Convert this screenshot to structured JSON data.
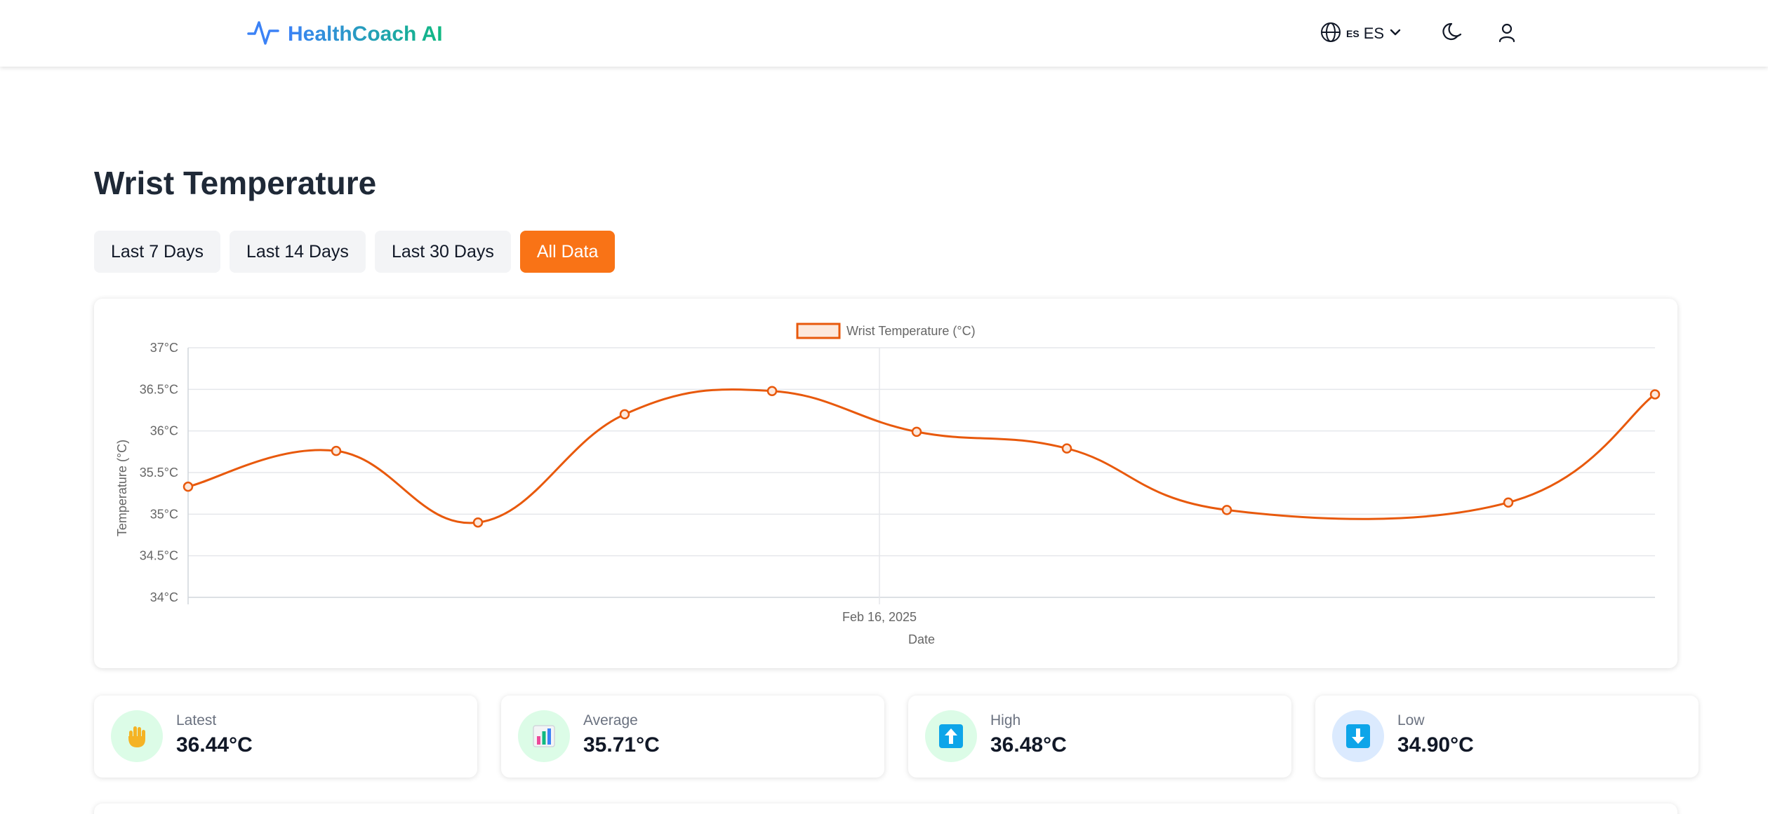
{
  "app": {
    "name": "HealthCoach AI"
  },
  "header": {
    "language_small": "ES",
    "language_code": "ES",
    "icons": [
      "globe-icon",
      "chevron-down-icon",
      "moon-icon",
      "user-icon"
    ]
  },
  "page": {
    "title": "Wrist Temperature"
  },
  "ranges": [
    {
      "label": "Last 7 Days",
      "active": false
    },
    {
      "label": "Last 14 Days",
      "active": false
    },
    {
      "label": "Last 30 Days",
      "active": false
    },
    {
      "label": "All Data",
      "active": true
    }
  ],
  "colors": {
    "accent": "#f97316",
    "line": "#e8590c",
    "grid": "#e5e7eb"
  },
  "chart_data": {
    "type": "line",
    "legend": {
      "label": "Wrist Temperature (°C)",
      "position": "top-center"
    },
    "xlabel": "Date",
    "ylabel": "Temperature (°C)",
    "x_tick_labels": [
      "Feb 16, 2025"
    ],
    "y_ticks": [
      "34°C",
      "34.5°C",
      "35°C",
      "35.5°C",
      "36°C",
      "36.5°C",
      "37°C"
    ],
    "ylim": [
      34,
      37
    ],
    "grid": true,
    "series": [
      {
        "name": "Wrist Temperature (°C)",
        "values": [
          35.33,
          35.76,
          34.9,
          36.2,
          36.48,
          35.99,
          35.79,
          35.05,
          35.14,
          36.44
        ]
      }
    ]
  },
  "stats": [
    {
      "label": "Latest",
      "value": "36.44°C",
      "icon": "hand-icon"
    },
    {
      "label": "Average",
      "value": "35.71°C",
      "icon": "bar-chart-icon"
    },
    {
      "label": "High",
      "value": "36.48°C",
      "icon": "up-arrow-icon"
    },
    {
      "label": "Low",
      "value": "34.90°C",
      "icon": "down-arrow-icon"
    }
  ]
}
